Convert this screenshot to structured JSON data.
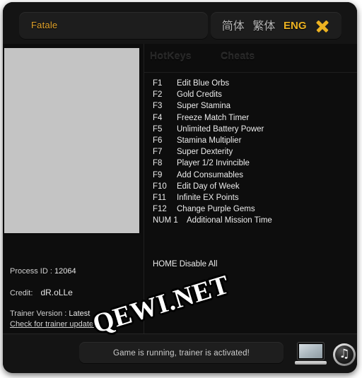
{
  "titlebar": {
    "game_title": "Fatale",
    "languages": [
      {
        "label": "简体",
        "active": false,
        "name": "lang-simplified-chinese"
      },
      {
        "label": "繁体",
        "active": false,
        "name": "lang-traditional-chinese"
      },
      {
        "label": "ENG",
        "active": true,
        "name": "lang-english"
      }
    ],
    "close_icon": "close-icon",
    "accent_color": "#ecb221",
    "title_color": "#e2a32b"
  },
  "tabs": [
    {
      "label": "HotKeys",
      "name": "tab-hotkeys"
    },
    {
      "label": "Cheats",
      "name": "tab-cheats"
    }
  ],
  "cheats": [
    {
      "key": "F1",
      "label": "Edit Blue Orbs"
    },
    {
      "key": "F2",
      "label": "Gold Credits"
    },
    {
      "key": "F3",
      "label": "Super Stamina"
    },
    {
      "key": "F4",
      "label": "Freeze Match Timer"
    },
    {
      "key": "F5",
      "label": "Unlimited Battery Power"
    },
    {
      "key": "F6",
      "label": "Stamina Multiplier"
    },
    {
      "key": "F7",
      "label": "Super Dexterity"
    },
    {
      "key": "F8",
      "label": "Player 1/2 Invincible"
    },
    {
      "key": "F9",
      "label": "Add Consumables"
    },
    {
      "key": "F10",
      "label": "Edit Day of Week"
    },
    {
      "key": "F11",
      "label": "Infinite EX Points"
    },
    {
      "key": "F12",
      "label": "Change Purple Gems"
    },
    {
      "key": "NUM 1",
      "label": "Additional Mission Time"
    }
  ],
  "disable_all": {
    "key": "HOME",
    "label": "Disable All",
    "full": "HOME Disable All"
  },
  "info": {
    "process_id_label": "Process ID :",
    "process_id_value": "12064",
    "credit_label": "Credit:",
    "credit_value": "dR.oLLe",
    "trainer_version_label": "Trainer Version :",
    "trainer_version_value": "Latest",
    "update_link": "Check for trainer updates"
  },
  "status": {
    "message": "Game is running, trainer is activated!"
  },
  "bottom_icons": [
    {
      "name": "laptop-icon"
    },
    {
      "name": "music-note-icon",
      "glyph": "♫"
    }
  ],
  "watermark": {
    "text": "QEWI.NET"
  }
}
